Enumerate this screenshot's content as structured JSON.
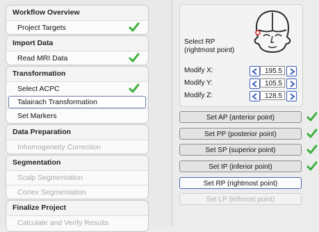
{
  "colors": {
    "check": "#3bb03b",
    "accent": "#3b5dbb",
    "selected_border": "#4d63a8"
  },
  "workflow": {
    "groups": [
      {
        "title": "Workflow Overview",
        "items": [
          {
            "label": "Project Targets",
            "done": true
          }
        ]
      },
      {
        "title": "Import Data",
        "items": [
          {
            "label": "Read MRI Data",
            "done": true
          }
        ]
      },
      {
        "title": "Transformation",
        "items": [
          {
            "label": "Select ACPC",
            "done": true
          },
          {
            "label": "Talairach Transformation",
            "selected": true
          },
          {
            "label": "Set Markers"
          }
        ]
      },
      {
        "title": "Data Preparation",
        "items": [
          {
            "label": "Inhomogeneity Correction",
            "disabled": true
          }
        ]
      },
      {
        "title": "Segmentation",
        "items": [
          {
            "label": "Scalp Segmentation",
            "disabled": true
          },
          {
            "label": "Cortex Segmentation",
            "disabled": true
          }
        ]
      },
      {
        "title": "Finalize Project",
        "items": [
          {
            "label": "Calculate and Verify Results",
            "disabled": true
          }
        ]
      }
    ]
  },
  "panel": {
    "select_label_1": "Select RP",
    "select_label_2": "(rightmost point)",
    "head_icon": "head-front-view-icon",
    "modify": [
      {
        "label": "Modify X:",
        "value": "195.5"
      },
      {
        "label": "Modify Y:",
        "value": "105.5"
      },
      {
        "label": "Modify Z:",
        "value": "128.5"
      }
    ],
    "buttons": [
      {
        "label": "Set AP (anterior point)",
        "done": true
      },
      {
        "label": "Set PP (posterior point)",
        "done": true
      },
      {
        "label": "Set SP (superior point)",
        "done": true
      },
      {
        "label": "Set IP (inferior point)",
        "done": true
      },
      {
        "label": "Set RP (rightmost point)",
        "active": true
      },
      {
        "label": "Set LP (leftmost point)",
        "disabled": true
      }
    ]
  }
}
